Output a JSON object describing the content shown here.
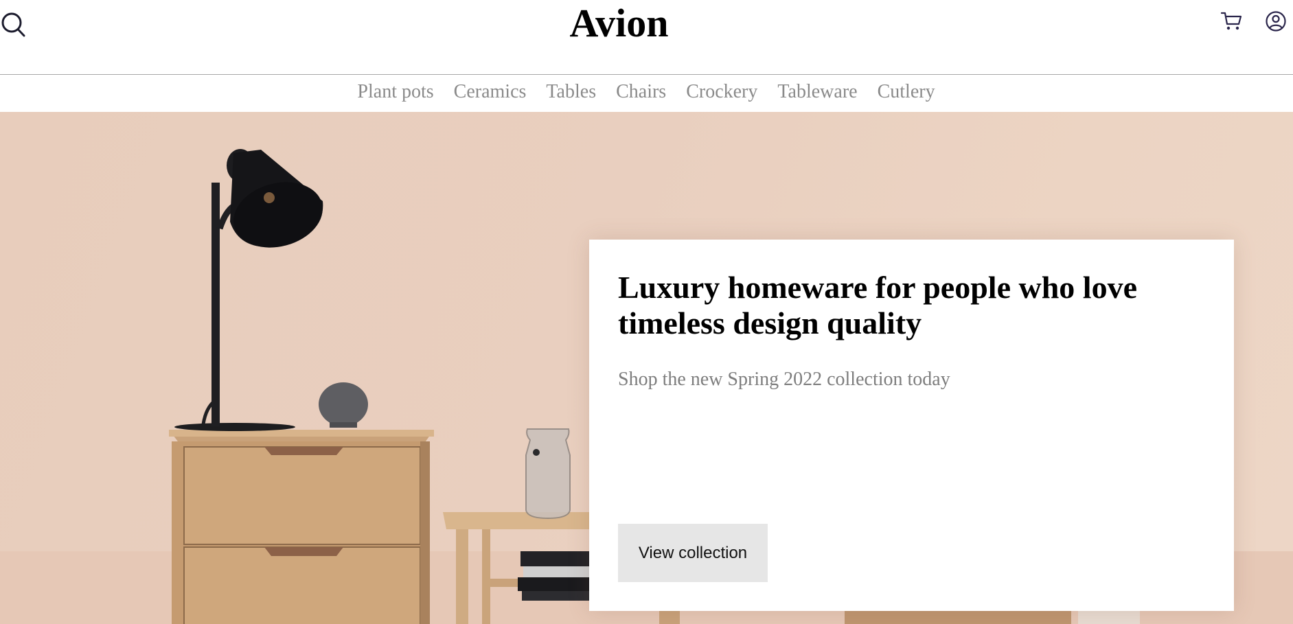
{
  "header": {
    "brand": "Avion",
    "icons": [
      "search-icon",
      "cart-icon",
      "account-icon"
    ]
  },
  "nav": {
    "items": [
      "Plant pots",
      "Ceramics",
      "Tables",
      "Chairs",
      "Crockery",
      "Tableware",
      "Cutlery"
    ]
  },
  "hero": {
    "title": "Luxury homeware for people who love timeless design quality",
    "subtitle": "Shop the new Spring 2022 collection today",
    "button_label": "View collection"
  },
  "colors": {
    "nav_text": "#8a8a8a",
    "hero_background": "#e9cfbf",
    "button_background": "#e6e6e6",
    "icon_color": "#2a254b"
  }
}
